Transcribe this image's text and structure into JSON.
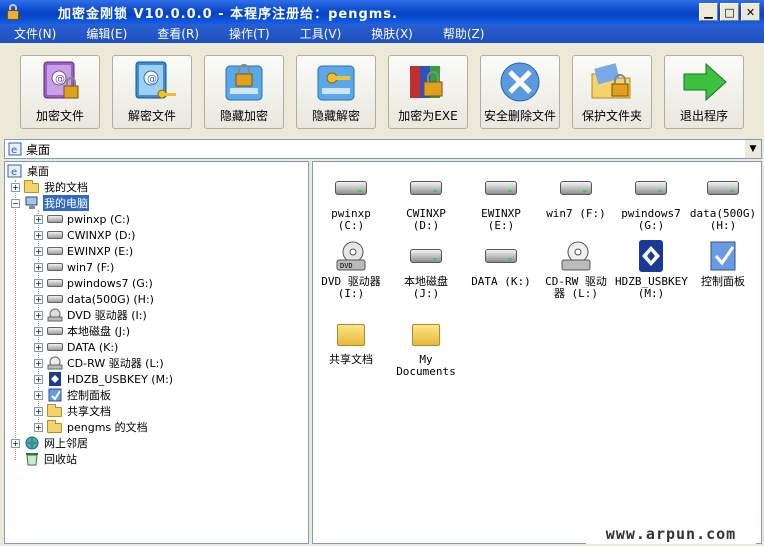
{
  "window": {
    "title": "加密金刚锁 V10.0.0.0 - 本程序注册给：pengms."
  },
  "menu": [
    "文件(N)",
    "编辑(E)",
    "查看(R)",
    "操作(T)",
    "工具(V)",
    "换肤(X)",
    "帮助(Z)"
  ],
  "toolbar": [
    {
      "label": "加密文件",
      "icon": "book-lock-icon"
    },
    {
      "label": "解密文件",
      "icon": "book-key-icon"
    },
    {
      "label": "隐藏加密",
      "icon": "drive-lock-icon"
    },
    {
      "label": "隐藏解密",
      "icon": "drive-key-icon"
    },
    {
      "label": "加密为EXE",
      "icon": "archive-lock-icon"
    },
    {
      "label": "安全删除文件",
      "icon": "delete-x-icon"
    },
    {
      "label": "保护文件夹",
      "icon": "folder-lock-icon"
    },
    {
      "label": "退出程序",
      "icon": "exit-arrow-icon"
    }
  ],
  "address": {
    "value": "桌面"
  },
  "tree": [
    {
      "label": "桌面"
    },
    {
      "label": "我的文档"
    },
    {
      "label": "我的电脑"
    },
    {
      "label": "pwinxp (C:)"
    },
    {
      "label": "CWINXP (D:)"
    },
    {
      "label": "EWINXP (E:)"
    },
    {
      "label": "win7 (F:)"
    },
    {
      "label": "pwindows7 (G:)"
    },
    {
      "label": "data(500G) (H:)"
    },
    {
      "label": "DVD 驱动器 (I:)"
    },
    {
      "label": "本地磁盘 (J:)"
    },
    {
      "label": "DATA (K:)"
    },
    {
      "label": "CD-RW 驱动器 (L:)"
    },
    {
      "label": "HDZB_USBKEY (M:)"
    },
    {
      "label": "控制面板"
    },
    {
      "label": "共享文档"
    },
    {
      "label": "pengms 的文档"
    },
    {
      "label": "网上邻居"
    },
    {
      "label": "回收站"
    }
  ],
  "items": [
    {
      "label": "pwinxp (C:)",
      "icon": "hard-drive-icon"
    },
    {
      "label": "CWINXP (D:)",
      "icon": "hard-drive-icon"
    },
    {
      "label": "EWINXP (E:)",
      "icon": "hard-drive-icon"
    },
    {
      "label": "win7 (F:)",
      "icon": "hard-drive-icon"
    },
    {
      "label": "pwindows7 (G:)",
      "icon": "hard-drive-icon"
    },
    {
      "label": "data(500G) (H:)",
      "icon": "hard-drive-icon"
    },
    {
      "label": "DVD 驱动器 (I:)",
      "icon": "dvd-drive-icon"
    },
    {
      "label": "本地磁盘 (J:)",
      "icon": "hard-drive-icon"
    },
    {
      "label": "DATA (K:)",
      "icon": "hard-drive-icon"
    },
    {
      "label": "CD-RW 驱动器 (L:)",
      "icon": "cd-drive-icon"
    },
    {
      "label": "HDZB_USBKEY (M:)",
      "icon": "usb-key-icon"
    },
    {
      "label": "控制面板",
      "icon": "control-panel-icon"
    },
    {
      "label": "共享文档",
      "icon": "folder-icon"
    },
    {
      "label": "My Documents",
      "icon": "folder-icon"
    }
  ],
  "watermark": "www.arpun.com",
  "colors": {
    "titlebar": "#0a49cd",
    "selection": "#316ac5",
    "menubar": "#2a5fd1"
  }
}
